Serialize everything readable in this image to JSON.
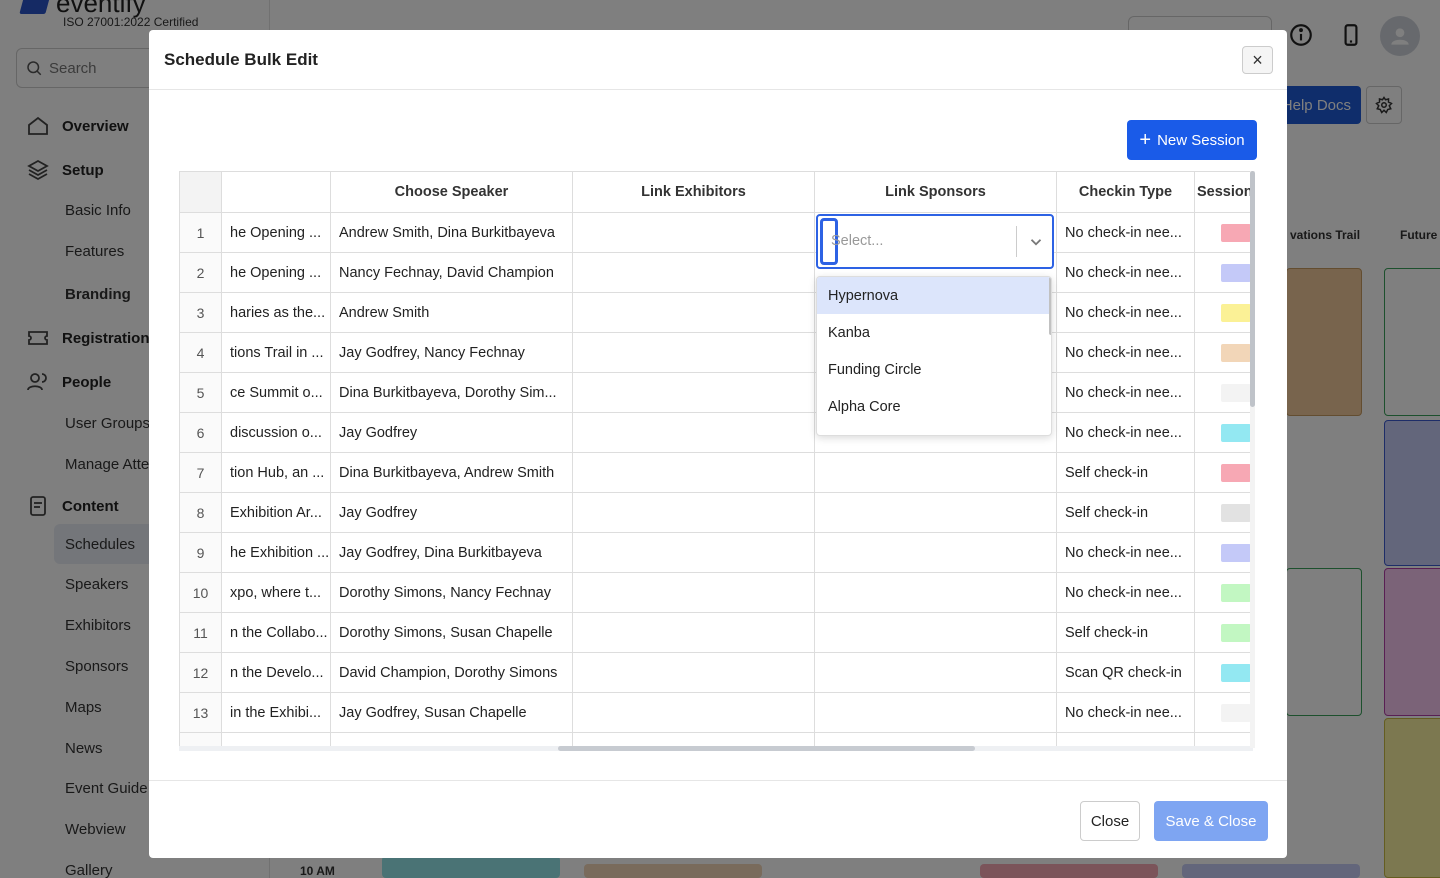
{
  "app": {
    "iso": "ISO 27001:2022 Certified",
    "search_placeholder": "Search",
    "nav": {
      "overview": "Overview",
      "setup": "Setup",
      "basic_info": "Basic Info",
      "features": "Features",
      "branding": "Branding",
      "registration": "Registration",
      "people": "People",
      "user_groups": "User Groups",
      "manage_attendees": "Manage Atte",
      "content": "Content",
      "schedules": "Schedules",
      "speakers": "Speakers",
      "exhibitors": "Exhibitors",
      "sponsors": "Sponsors",
      "maps": "Maps",
      "news": "News",
      "event_guide": "Event Guide",
      "webview": "Webview",
      "gallery": "Gallery"
    },
    "help_docs": "Help Docs",
    "calendar": {
      "col1": "vations Trail",
      "col2": "Future",
      "time": "10 AM"
    }
  },
  "modal": {
    "title": "Schedule Bulk Edit",
    "new_session": "New Session",
    "columns": {
      "speaker": "Choose Speaker",
      "exhibitors": "Link Exhibitors",
      "sponsors": "Link Sponsors",
      "checkin": "Checkin Type",
      "session": "Session"
    },
    "rows": [
      {
        "n": "1",
        "desc": "he Opening ...",
        "speaker": "Andrew Smith, Dina Burkitbayeva",
        "checkin": "No check-in nee...",
        "color": "#f7a8b4"
      },
      {
        "n": "2",
        "desc": "he Opening ...",
        "speaker": "Nancy Fechnay, David Champion",
        "checkin": "No check-in nee...",
        "color": "#c4c9f8"
      },
      {
        "n": "3",
        "desc": "haries as the...",
        "speaker": "Andrew Smith",
        "checkin": "No check-in nee...",
        "color": "#fbf196"
      },
      {
        "n": "4",
        "desc": "tions Trail in ...",
        "speaker": "Jay Godfrey, Nancy Fechnay",
        "checkin": "No check-in nee...",
        "color": "#f2d6b8"
      },
      {
        "n": "5",
        "desc": "ce Summit o...",
        "speaker": "Dina Burkitbayeva, Dorothy Sim...",
        "checkin": "No check-in nee...",
        "color": "#f3f3f3"
      },
      {
        "n": "6",
        "desc": " discussion o...",
        "speaker": "Jay Godfrey",
        "checkin": "No check-in nee...",
        "color": "#93e8f2"
      },
      {
        "n": "7",
        "desc": "tion Hub, an ...",
        "speaker": "Dina Burkitbayeva, Andrew Smith",
        "checkin": "Self check-in",
        "color": "#f7a8b4"
      },
      {
        "n": "8",
        "desc": "Exhibition Ar...",
        "speaker": "Jay Godfrey",
        "checkin": "Self check-in",
        "color": "#e2e2e2"
      },
      {
        "n": "9",
        "desc": "he Exhibition ...",
        "speaker": "Jay Godfrey, Dina Burkitbayeva",
        "checkin": "No check-in nee...",
        "color": "#c4c9f8"
      },
      {
        "n": "10",
        "desc": "xpo, where t...",
        "speaker": "Dorothy Simons, Nancy Fechnay",
        "checkin": "No check-in nee...",
        "color": "#c2f7c2"
      },
      {
        "n": "11",
        "desc": "n the Collabo...",
        "speaker": "Dorothy Simons, Susan Chapelle",
        "checkin": "Self check-in",
        "color": "#c2f7c2"
      },
      {
        "n": "12",
        "desc": "n the Develo...",
        "speaker": "David Champion, Dorothy Simons",
        "checkin": "Scan QR check-in",
        "color": "#93e8f2"
      },
      {
        "n": "13",
        "desc": " in the Exhibi...",
        "speaker": "Jay Godfrey, Susan Chapelle",
        "checkin": "No check-in nee...",
        "color": "#f3f3f3"
      }
    ],
    "select_placeholder": "Select...",
    "options": [
      "Hypernova",
      "Kanba",
      "Funding Circle",
      "Alpha Core"
    ],
    "close": "Close",
    "save_close": "Save & Close"
  }
}
